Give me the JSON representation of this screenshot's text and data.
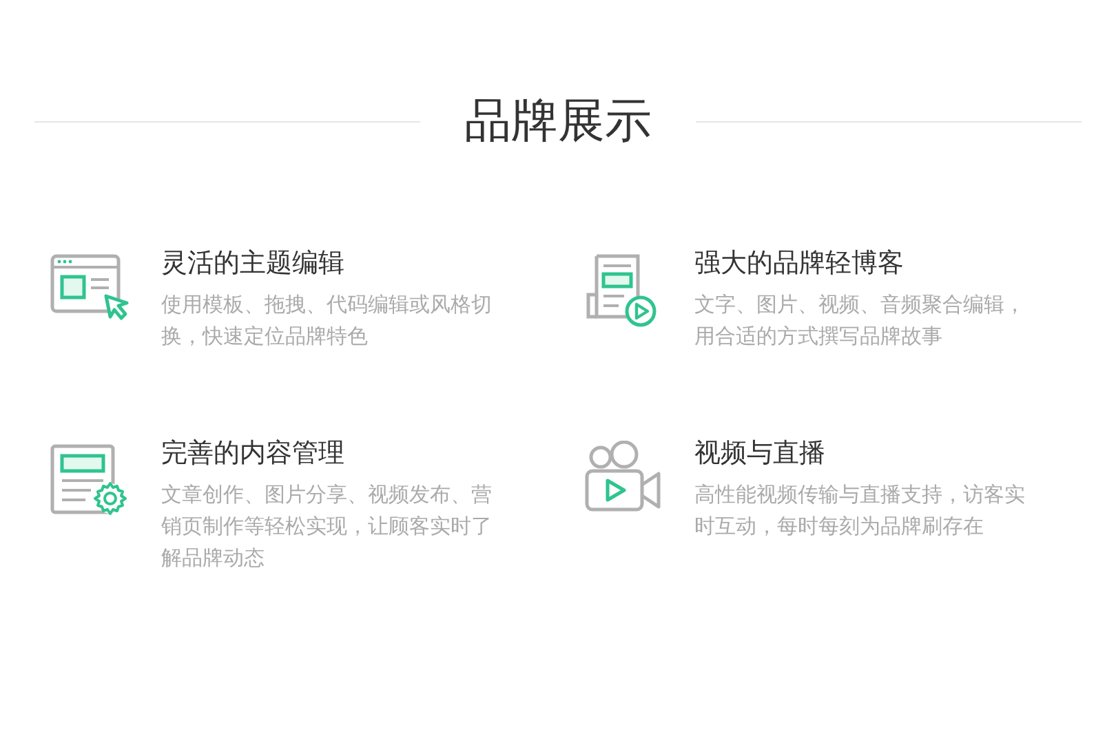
{
  "heading": "品牌展示",
  "features": [
    {
      "kind": "editor",
      "title": "灵活的主题编辑",
      "description": "使用模板、拖拽、代码编辑或风格切换，快速定位品牌特色"
    },
    {
      "kind": "blog",
      "title": "强大的品牌轻博客",
      "description": "文字、图片、视频、音频聚合编辑，用合适的方式撰写品牌故事"
    },
    {
      "kind": "content",
      "title": "完善的内容管理",
      "description": "文章创作、图片分享、视频发布、营销页制作等轻松实现，让顾客实时了解品牌动态"
    },
    {
      "kind": "video",
      "title": "视频与直播",
      "description": "高性能视频传输与直播支持，访客实时互动，每时每刻为品牌刷存在"
    }
  ]
}
